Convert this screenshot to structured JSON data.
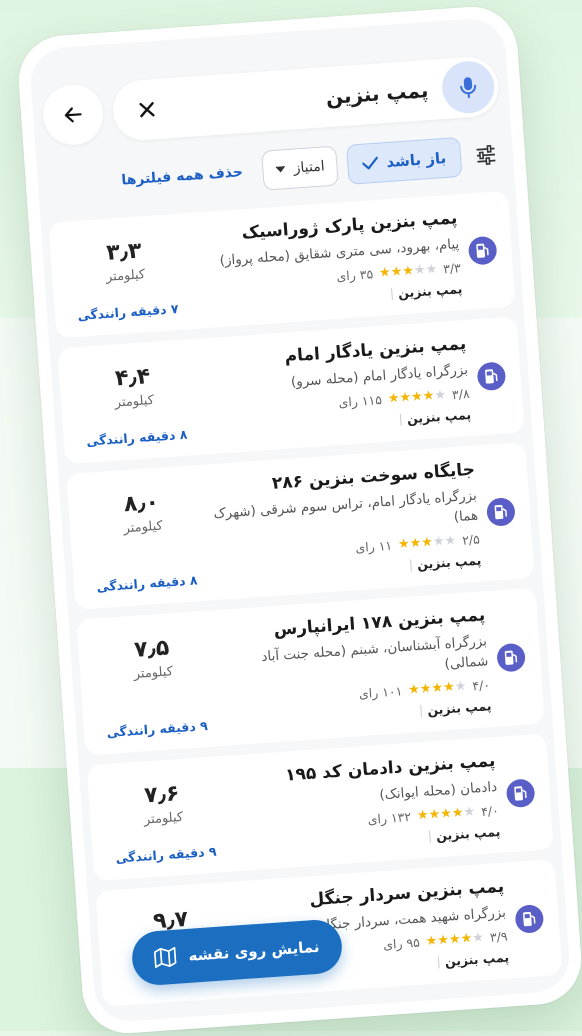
{
  "search": {
    "query": "پمپ بنزین"
  },
  "filters": {
    "open_now": "باز باشد",
    "rating": "امتیاز",
    "clear_all": "حذف همه فیلترها"
  },
  "colors": {
    "accent": "#1c5fc4",
    "star": "#f4b400",
    "star_empty": "#cfd3d9",
    "pump_icon": "#5a5fc8"
  },
  "results": [
    {
      "name": "پمپ بنزین پارک ژوراسیک",
      "address": "پیام، بهرود، سی متری شقایق (محله پرواز)",
      "rating": "۳/۳",
      "rating_value": 3.3,
      "reviews": "۳۵ رای",
      "category": "پمپ بنزین",
      "distance": "۳٫۳",
      "unit": "کیلومتر",
      "drive": "۷ دقیقه رانندگی"
    },
    {
      "name": "پمپ بنزین یادگار امام",
      "address": "بزرگراه یادگار امام (محله سرو)",
      "rating": "۳/۸",
      "rating_value": 3.8,
      "reviews": "۱۱۵ رای",
      "category": "پمپ بنزین",
      "distance": "۴٫۴",
      "unit": "کیلومتر",
      "drive": "۸ دقیقه رانندگی"
    },
    {
      "name": "جایگاه سوخت بنزین ۲۸۶",
      "address": "بزرگراه یادگار امام، تراس سوم شرقی (شهرک هما)",
      "rating": "۲/۵",
      "rating_value": 2.5,
      "reviews": "۱۱ رای",
      "category": "پمپ بنزین",
      "distance": "۸٫۰",
      "unit": "کیلومتر",
      "drive": "۸ دقیقه رانندگی"
    },
    {
      "name": "پمپ بنزین ۱۷۸ ایرانپارس",
      "address": "بزرگراه آبشناسان، شبنم (محله جنت آباد شمالی)",
      "rating": "۴/۰",
      "rating_value": 4.0,
      "reviews": "۱۰۱ رای",
      "category": "پمپ بنزین",
      "distance": "۷٫۵",
      "unit": "کیلومتر",
      "drive": "۹ دقیقه رانندگی"
    },
    {
      "name": "پمپ بنزین دادمان کد ۱۹۵",
      "address": "دادمان (محله ایوانک)",
      "rating": "۴/۰",
      "rating_value": 4.0,
      "reviews": "۱۳۲ رای",
      "category": "پمپ بنزین",
      "distance": "۷٫۶",
      "unit": "کیلومتر",
      "drive": "۹ دقیقه رانندگی"
    },
    {
      "name": "پمپ بنزین سردار جنگل",
      "address": "بزرگراه شهید همت، سردار جنگل (",
      "rating": "۳/۹",
      "rating_value": 3.9,
      "reviews": "۹۵ رای",
      "category": "پمپ بنزین",
      "distance": "۹٫۷",
      "unit": "کیلومتر",
      "drive": ""
    }
  ],
  "map_button": {
    "label": "نمایش روی نقشه"
  }
}
